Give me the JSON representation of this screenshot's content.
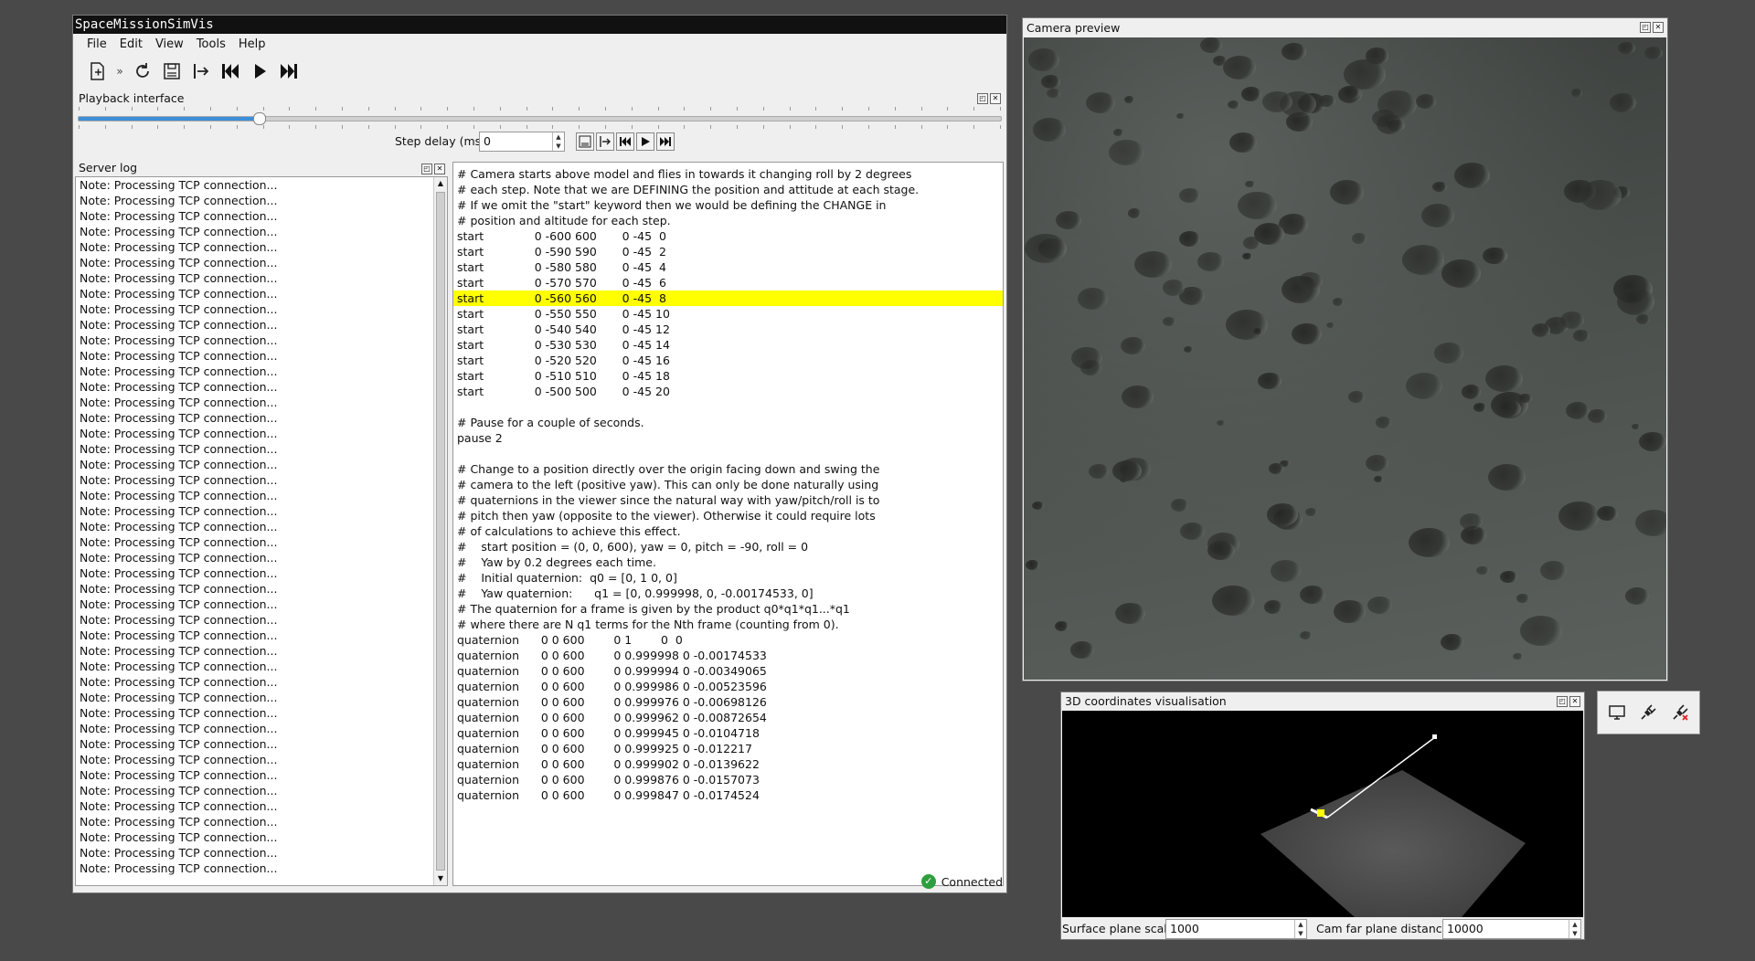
{
  "app": {
    "title": "SpaceMissionSimVis"
  },
  "menu": [
    "File",
    "Edit",
    "View",
    "Tools",
    "Help"
  ],
  "toolbar": {
    "icons": [
      "new-script-icon",
      "more-chevron-icon",
      "reload-icon",
      "save-icon",
      "step-to-icon",
      "skip-to-start-icon",
      "play-icon",
      "skip-to-end-icon"
    ],
    "overflow": "»"
  },
  "playback": {
    "title": "Playback interface",
    "slider_position_fraction": 0.195,
    "step_delay_label": "Step delay (ms)",
    "step_delay_value": "0"
  },
  "server_log": {
    "title": "Server log",
    "lines": [
      "Note: Processing TCP connection...",
      "Note: Processing TCP connection...",
      "Note: Processing TCP connection...",
      "Note: Processing TCP connection...",
      "Note: Processing TCP connection...",
      "Note: Processing TCP connection...",
      "Note: Processing TCP connection...",
      "Note: Processing TCP connection...",
      "Note: Processing TCP connection...",
      "Note: Processing TCP connection...",
      "Note: Processing TCP connection...",
      "Note: Processing TCP connection...",
      "Note: Processing TCP connection...",
      "Note: Processing TCP connection...",
      "Note: Processing TCP connection...",
      "Note: Processing TCP connection...",
      "Note: Processing TCP connection...",
      "Note: Processing TCP connection...",
      "Note: Processing TCP connection...",
      "Note: Processing TCP connection...",
      "Note: Processing TCP connection...",
      "Note: Processing TCP connection...",
      "Note: Processing TCP connection...",
      "Note: Processing TCP connection...",
      "Note: Processing TCP connection...",
      "Note: Processing TCP connection...",
      "Note: Processing TCP connection...",
      "Note: Processing TCP connection...",
      "Note: Processing TCP connection...",
      "Note: Processing TCP connection...",
      "Note: Processing TCP connection...",
      "Note: Processing TCP connection...",
      "Note: Processing TCP connection...",
      "Note: Processing TCP connection...",
      "Note: Processing TCP connection...",
      "Note: Processing TCP connection...",
      "Note: Processing TCP connection...",
      "Note: Processing TCP connection...",
      "Note: Processing TCP connection...",
      "Note: Processing TCP connection...",
      "Note: Processing TCP connection...",
      "Note: Processing TCP connection...",
      "Note: Processing TCP connection...",
      "Note: Processing TCP connection...",
      "Note: Processing TCP connection..."
    ]
  },
  "script": {
    "highlighted_line": 8,
    "lines": [
      "# Camera starts above model and flies in towards it changing roll by 2 degrees",
      "# each step. Note that we are DEFINING the position and attitude at each stage.",
      "# If we omit the \"start\" keyword then we would be defining the CHANGE in",
      "# position and altitude for each step.",
      "start              0 -600 600       0 -45  0",
      "start              0 -590 590       0 -45  2",
      "start              0 -580 580       0 -45  4",
      "start              0 -570 570       0 -45  6",
      "start              0 -560 560       0 -45  8",
      "start              0 -550 550       0 -45 10",
      "start              0 -540 540       0 -45 12",
      "start              0 -530 530       0 -45 14",
      "start              0 -520 520       0 -45 16",
      "start              0 -510 510       0 -45 18",
      "start              0 -500 500       0 -45 20",
      "",
      "# Pause for a couple of seconds.",
      "pause 2",
      "",
      "# Change to a position directly over the origin facing down and swing the",
      "# camera to the left (positive yaw). This can only be done naturally using",
      "# quaternions in the viewer since the natural way with yaw/pitch/roll is to",
      "# pitch then yaw (opposite to the viewer). Otherwise it could require lots",
      "# of calculations to achieve this effect.",
      "#    start position = (0, 0, 600), yaw = 0, pitch = -90, roll = 0",
      "#    Yaw by 0.2 degrees each time.",
      "#    Initial quaternion:  q0 = [0, 1 0, 0]",
      "#    Yaw quaternion:      q1 = [0, 0.999998, 0, -0.00174533, 0]",
      "# The quaternion for a frame is given by the product q0*q1*q1...*q1",
      "# where there are N q1 terms for the Nth frame (counting from 0).",
      "quaternion      0 0 600        0 1        0  0",
      "quaternion      0 0 600        0 0.999998 0 -0.00174533",
      "quaternion      0 0 600        0 0.999994 0 -0.00349065",
      "quaternion      0 0 600        0 0.999986 0 -0.00523596",
      "quaternion      0 0 600        0 0.999976 0 -0.00698126",
      "quaternion      0 0 600        0 0.999962 0 -0.00872654",
      "quaternion      0 0 600        0 0.999945 0 -0.0104718",
      "quaternion      0 0 600        0 0.999925 0 -0.012217",
      "quaternion      0 0 600        0 0.999902 0 -0.0139622",
      "quaternion      0 0 600        0 0.999876 0 -0.0157073",
      "quaternion      0 0 600        0 0.999847 0 -0.0174524"
    ]
  },
  "status": {
    "text": "Connected",
    "color": "#2e9e3e"
  },
  "camera_preview": {
    "title": "Camera preview"
  },
  "coords_vis": {
    "title": "3D coordinates visualisation",
    "surface_label": "Surface plane scale",
    "surface_value": "1000",
    "farplane_label": "Cam far plane distance",
    "farplane_value": "10000"
  },
  "connection_box": {
    "icons": [
      "monitor-icon",
      "connect-plug-icon",
      "disconnect-plug-icon"
    ]
  },
  "colors": {
    "highlight": "#ffff00",
    "slider": "#3c8fd8",
    "background": "#494949"
  }
}
